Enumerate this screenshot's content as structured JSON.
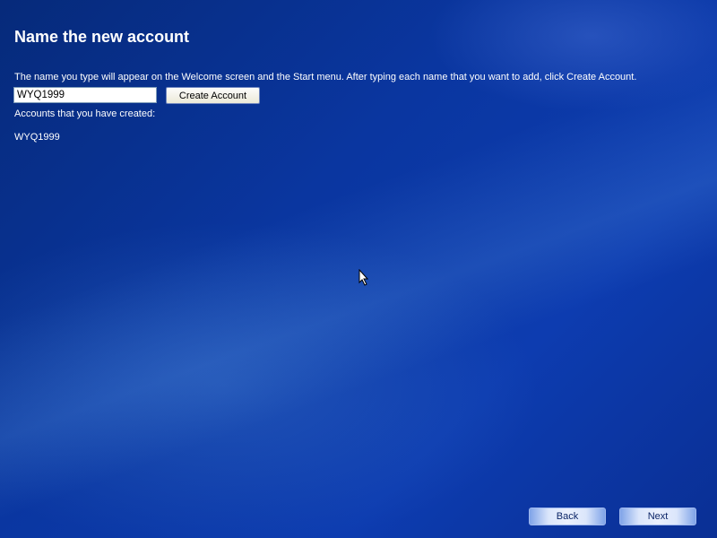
{
  "page": {
    "title": "Name the new account",
    "description": "The name you type will appear on the Welcome screen and the Start menu. After typing each name that you want to add, click Create Account.",
    "name_input_value": "WYQ1999",
    "create_button": "Create Account",
    "accounts_label": "Accounts that you have created:",
    "accounts": [
      "WYQ1999"
    ]
  },
  "nav": {
    "back": "Back",
    "next": "Next"
  }
}
